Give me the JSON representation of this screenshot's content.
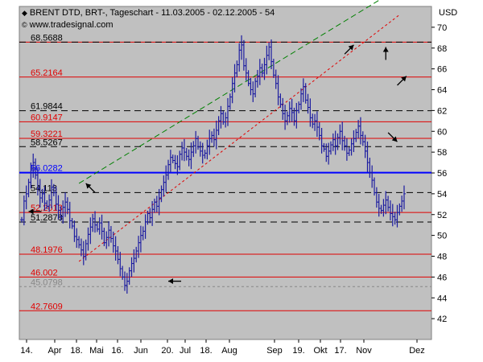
{
  "header": {
    "title": "BRENT DTD, BRT-, Tageschart - 11.03.2005 - 02.12.2005 - 54",
    "source": "www.tradesignal.com",
    "currency": "USD",
    "title_icon": "diamond-icon",
    "source_icon": "copyright-icon"
  },
  "colors": {
    "plot_bg": "#c0c0c0",
    "bars": "#1c1ca0",
    "red_level": "#e00000",
    "blue_level": "#0000ff",
    "black_dashed": "#000000",
    "green_trend": "#008000",
    "red_trend": "#e00000"
  },
  "chart_data": {
    "type": "ohlc",
    "title": "BRENT DTD, BRT-, Tageschart - 11.03.2005 - 02.12.2005 - 54",
    "ylabel": "USD",
    "ylim": [
      40,
      72
    ],
    "y_ticks": [
      42,
      44,
      46,
      48,
      50,
      52,
      54,
      56,
      58,
      60,
      62,
      64,
      66,
      68,
      70
    ],
    "x_labels": [
      "14.",
      "Apr",
      "18.",
      "Mai",
      "16.",
      "Jun",
      "20.",
      "Jul",
      "18.",
      "Aug",
      "Sep",
      "19.",
      "Okt",
      "17.",
      "Nov",
      "Dez"
    ],
    "grid": false,
    "close_series": [
      51.5,
      53.3,
      54.0,
      55.1,
      56.4,
      57.0,
      55.8,
      54.5,
      53.6,
      54.0,
      53.1,
      52.8,
      53.4,
      54.6,
      54.1,
      53.0,
      52.4,
      51.8,
      52.7,
      53.2,
      52.5,
      51.4,
      50.9,
      49.9,
      49.6,
      49.1,
      48.6,
      48.0,
      49.2,
      50.1,
      50.8,
      51.6,
      51.0,
      50.6,
      51.2,
      50.4,
      49.3,
      49.8,
      50.5,
      49.7,
      49.0,
      48.5,
      47.7,
      46.8,
      46.0,
      45.2,
      45.6,
      46.6,
      47.3,
      47.8,
      48.5,
      49.3,
      50.0,
      50.4,
      51.3,
      52.1,
      51.7,
      52.5,
      53.2,
      52.8,
      53.6,
      54.4,
      55.1,
      55.8,
      56.8,
      57.5,
      57.2,
      56.9,
      56.6,
      57.8,
      58.4,
      58.0,
      57.6,
      57.3,
      58.0,
      58.6,
      59.3,
      58.5,
      58.1,
      57.7,
      57.9,
      58.6,
      59.3,
      59.6,
      59.2,
      60.1,
      61.0,
      61.7,
      60.9,
      61.3,
      62.4,
      63.3,
      64.6,
      65.6,
      66.4,
      67.8,
      68.3,
      66.3,
      65.6,
      64.6,
      64.0,
      63.6,
      64.8,
      65.3,
      66.1,
      65.6,
      66.4,
      67.3,
      68.1,
      66.7,
      65.4,
      64.6,
      63.3,
      62.6,
      61.7,
      61.0,
      61.5,
      62.2,
      61.8,
      61.0,
      62.0,
      62.6,
      63.6,
      64.3,
      63.0,
      62.3,
      61.3,
      60.7,
      61.0,
      60.4,
      59.6,
      58.6,
      58.3,
      57.6,
      58.1,
      58.7,
      59.2,
      58.6,
      59.4,
      60.0,
      59.1,
      58.6,
      57.9,
      58.2,
      58.8,
      59.3,
      59.9,
      60.5,
      59.6,
      59.0,
      58.1,
      57.0,
      56.0,
      55.3,
      54.1,
      53.2,
      52.6,
      52.4,
      52.9,
      53.4,
      52.7,
      52.1,
      51.8,
      51.5,
      52.2,
      52.8,
      53.3,
      54.0
    ],
    "reference_levels": [
      {
        "label": "68.5688",
        "value": 68.5688,
        "color": "red",
        "label_color": "#000000",
        "dashed": false
      },
      {
        "label": "68.5688",
        "value": 68.5688,
        "color": "black",
        "dashed": true
      },
      {
        "label": "65.2164",
        "value": 65.2164,
        "color": "red",
        "dashed": false
      },
      {
        "label": "61.9844",
        "value": 61.9844,
        "color": "black",
        "dashed": true
      },
      {
        "label": "60.9147",
        "value": 60.9147,
        "color": "red",
        "dashed": false
      },
      {
        "label": "59.3221",
        "value": 59.3221,
        "color": "red",
        "dashed": false
      },
      {
        "label": "58.5267",
        "value": 58.5267,
        "color": "black",
        "dashed": true
      },
      {
        "label": "56.0282",
        "value": 56.0282,
        "color": "blue",
        "dashed": false
      },
      {
        "label": "54.113",
        "value": 54.113,
        "color": "black",
        "dashed": true
      },
      {
        "label": "52.2013",
        "value": 52.2013,
        "color": "red",
        "dashed": false
      },
      {
        "label": "51.2878",
        "value": 51.2878,
        "color": "black",
        "dashed": true
      },
      {
        "label": "48.1976",
        "value": 48.1976,
        "color": "red",
        "dashed": false
      },
      {
        "label": "46.002",
        "value": 46.002,
        "color": "red",
        "dashed": false
      },
      {
        "label": "45.0798",
        "value": 45.0798,
        "color": "gray",
        "dashed": true
      },
      {
        "label": "42.7609",
        "value": 42.7609,
        "color": "red",
        "dashed": false
      }
    ],
    "trend_lines": [
      {
        "color": "green",
        "from_index": 25,
        "from_value": 55.0,
        "to_index": 165,
        "to_value": 73.8
      },
      {
        "color": "red",
        "from_index": 25,
        "from_value": 47.5,
        "to_index": 165,
        "to_value": 71.2
      }
    ],
    "annotation_arrows": [
      {
        "index": 3,
        "value": 52.3,
        "direction": "left"
      },
      {
        "index": 28,
        "value": 55.0,
        "direction": "down-left"
      },
      {
        "index": 64,
        "value": 45.6,
        "direction": "left"
      },
      {
        "index": 145,
        "value": 68.3,
        "direction": "down-right"
      },
      {
        "index": 159,
        "value": 68.1,
        "direction": "down"
      },
      {
        "index": 168,
        "value": 65.3,
        "direction": "down-right"
      },
      {
        "index": 164,
        "value": 59.0,
        "direction": "up-right"
      }
    ]
  }
}
